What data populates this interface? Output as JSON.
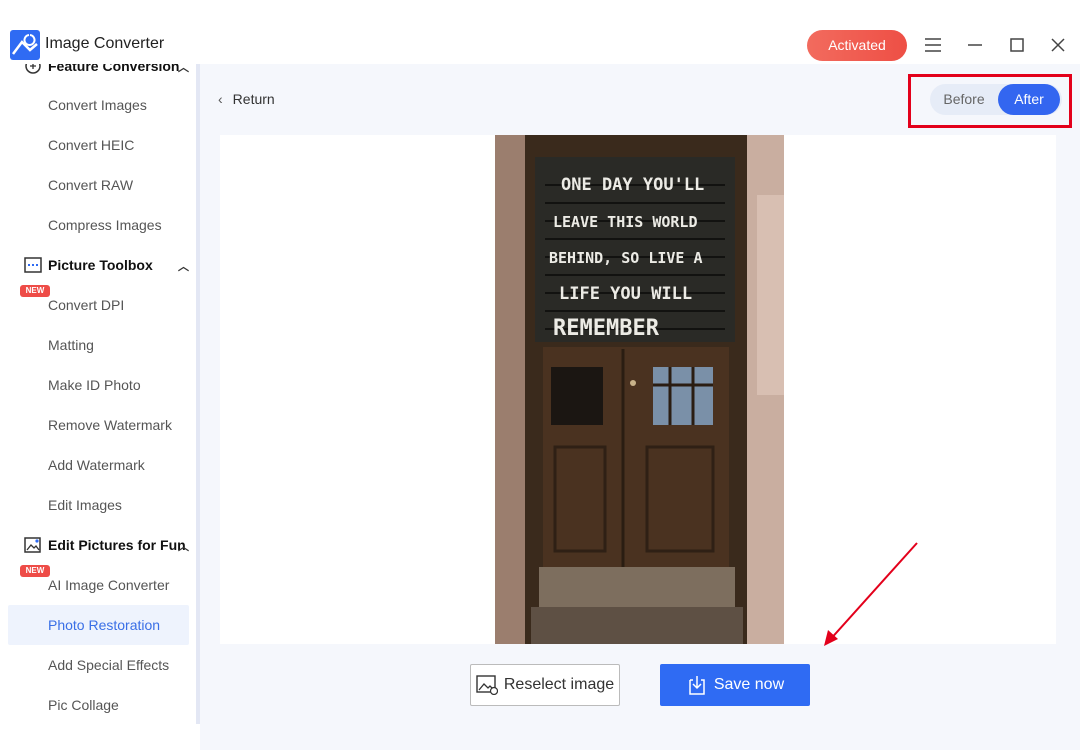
{
  "app": {
    "title": "Image Converter",
    "activated_label": "Activated"
  },
  "window_controls": [
    "menu-icon",
    "minimize-icon",
    "maximize-icon",
    "close-icon"
  ],
  "sidebar": {
    "sections": [
      {
        "label": "Feature Conversion",
        "icon": "convert-icon"
      },
      {
        "label": "Picture Toolbox",
        "icon": "toolbox-icon"
      },
      {
        "label": "Edit Pictures for Fun",
        "icon": "image-edit-icon"
      }
    ],
    "items": [
      {
        "label": "Convert Images"
      },
      {
        "label": "Convert HEIC"
      },
      {
        "label": "Convert RAW"
      },
      {
        "label": "Compress Images"
      },
      {
        "label": "Convert DPI",
        "badge": "NEW"
      },
      {
        "label": "Matting"
      },
      {
        "label": "Make ID Photo"
      },
      {
        "label": "Remove Watermark"
      },
      {
        "label": "Add Watermark"
      },
      {
        "label": "Edit Images"
      },
      {
        "label": "AI Image Converter",
        "badge": "NEW"
      },
      {
        "label": "Photo Restoration",
        "active": true
      },
      {
        "label": "Add Special Effects"
      },
      {
        "label": "Pic Collage"
      }
    ]
  },
  "main": {
    "return_label": "Return",
    "toggle": {
      "before": "Before",
      "after": "After",
      "selected": "After"
    },
    "photo": {
      "text_lines": [
        "ONE DAY YOU'LL",
        "LEAVE THIS WORLD",
        "BEHIND, SO LIVE A",
        "LIFE YOU WILL",
        "REMEMBER"
      ]
    },
    "reselect_label": "Reselect image",
    "save_label": "Save now"
  },
  "colors": {
    "accent": "#2f6bf3",
    "activated": "#ee4f45",
    "highlight_box": "#e3001b",
    "new_badge": "#ee4c47"
  }
}
